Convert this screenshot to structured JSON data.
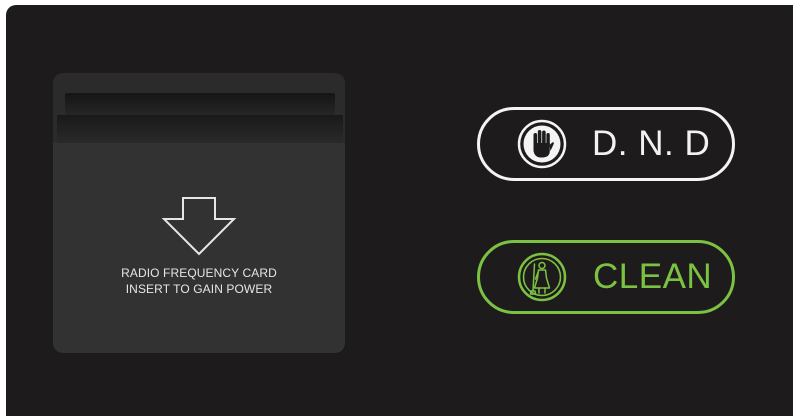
{
  "card_slot": {
    "line1": "RADIO FREQUENCY CARD",
    "line2": "INSERT TO GAIN POWER",
    "arrow_icon": "down-arrow-icon"
  },
  "buttons": {
    "dnd": {
      "label": "D. N. D",
      "icon": "hand-stop-icon",
      "color": "#f4f4f4"
    },
    "clean": {
      "label": "CLEAN",
      "icon": "maid-broom-icon",
      "color": "#7cc242"
    }
  },
  "colors": {
    "panel": "#1d1b1b",
    "slot": "#2c2b2b"
  }
}
